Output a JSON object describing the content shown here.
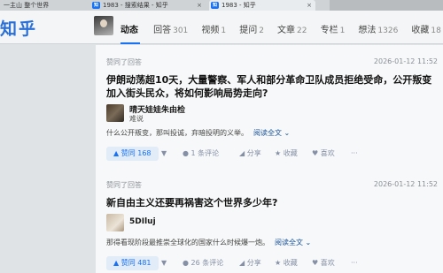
{
  "browser": {
    "tabs": [
      {
        "label": "一主山 整个世界",
        "icon": ""
      },
      {
        "label": "1983 - 搜索结果 - 知乎",
        "icon": "知"
      },
      {
        "label": "1983 - 知乎",
        "icon": "知"
      }
    ],
    "close_glyph": "×"
  },
  "header": {
    "logo": "知乎",
    "nav": [
      {
        "label": "动态",
        "count": ""
      },
      {
        "label": "回答",
        "count": "301"
      },
      {
        "label": "视频",
        "count": "1"
      },
      {
        "label": "提问",
        "count": "2"
      },
      {
        "label": "文章",
        "count": "22"
      },
      {
        "label": "专栏",
        "count": "1"
      },
      {
        "label": "想法",
        "count": "1326"
      },
      {
        "label": "收藏",
        "count": "18"
      }
    ]
  },
  "feed": [
    {
      "meta": "赞同了回答",
      "date": "2026-01-12 11:52",
      "title": "伊朗动荡超10天，大量警察、军人和部分革命卫队成员拒绝受命，公开叛变加入街头民众，将如何影响局势走向?",
      "author": "晴天娃娃朱由检",
      "author_bio": "难说",
      "excerpt": "什么公开叛变，那叫投诚，弃暗投明的义举。",
      "read_more": "阅读全文 ⌄",
      "vote": "▲ 赞同 168",
      "vote_down": "▼",
      "comments": "● 1 条评论",
      "share": "◢ 分享",
      "favorite": "★ 收藏",
      "like": "♥ 喜欢",
      "more": "···"
    },
    {
      "meta": "赞同了回答",
      "date": "2026-01-12 11:52",
      "title": "新自由主义还要再祸害这个世界多少年?",
      "author": "5DIluj",
      "author_bio": "",
      "excerpt": "那得看现阶段最推崇全球化的国家什么时候爆一炮。",
      "read_more": "阅读全文 ⌄",
      "vote": "▲ 赞同 481",
      "vote_down": "▼",
      "comments": "● 26 条评论",
      "share": "◢ 分享",
      "favorite": "★ 收藏",
      "like": "♥ 喜欢",
      "more": "···"
    }
  ]
}
